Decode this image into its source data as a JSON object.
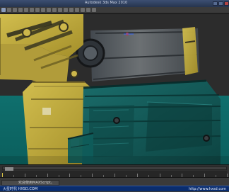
{
  "window": {
    "title": "Autodesk 3ds Max 2010"
  },
  "viewport": {
    "label": "",
    "colors": {
      "background": "#2b2b2b",
      "teal": "#0f7f7c",
      "yellow": "#c7b03a",
      "metal": "#5a5f63"
    }
  },
  "timeline": {
    "frame_start": 0,
    "frame_end": 100,
    "current_frame": 0
  },
  "status": {
    "text": "欢迎使用MAXScript。"
  },
  "banner": {
    "left": "火星时代  HXSD.COM",
    "right": "http://www.hxsd.com"
  }
}
